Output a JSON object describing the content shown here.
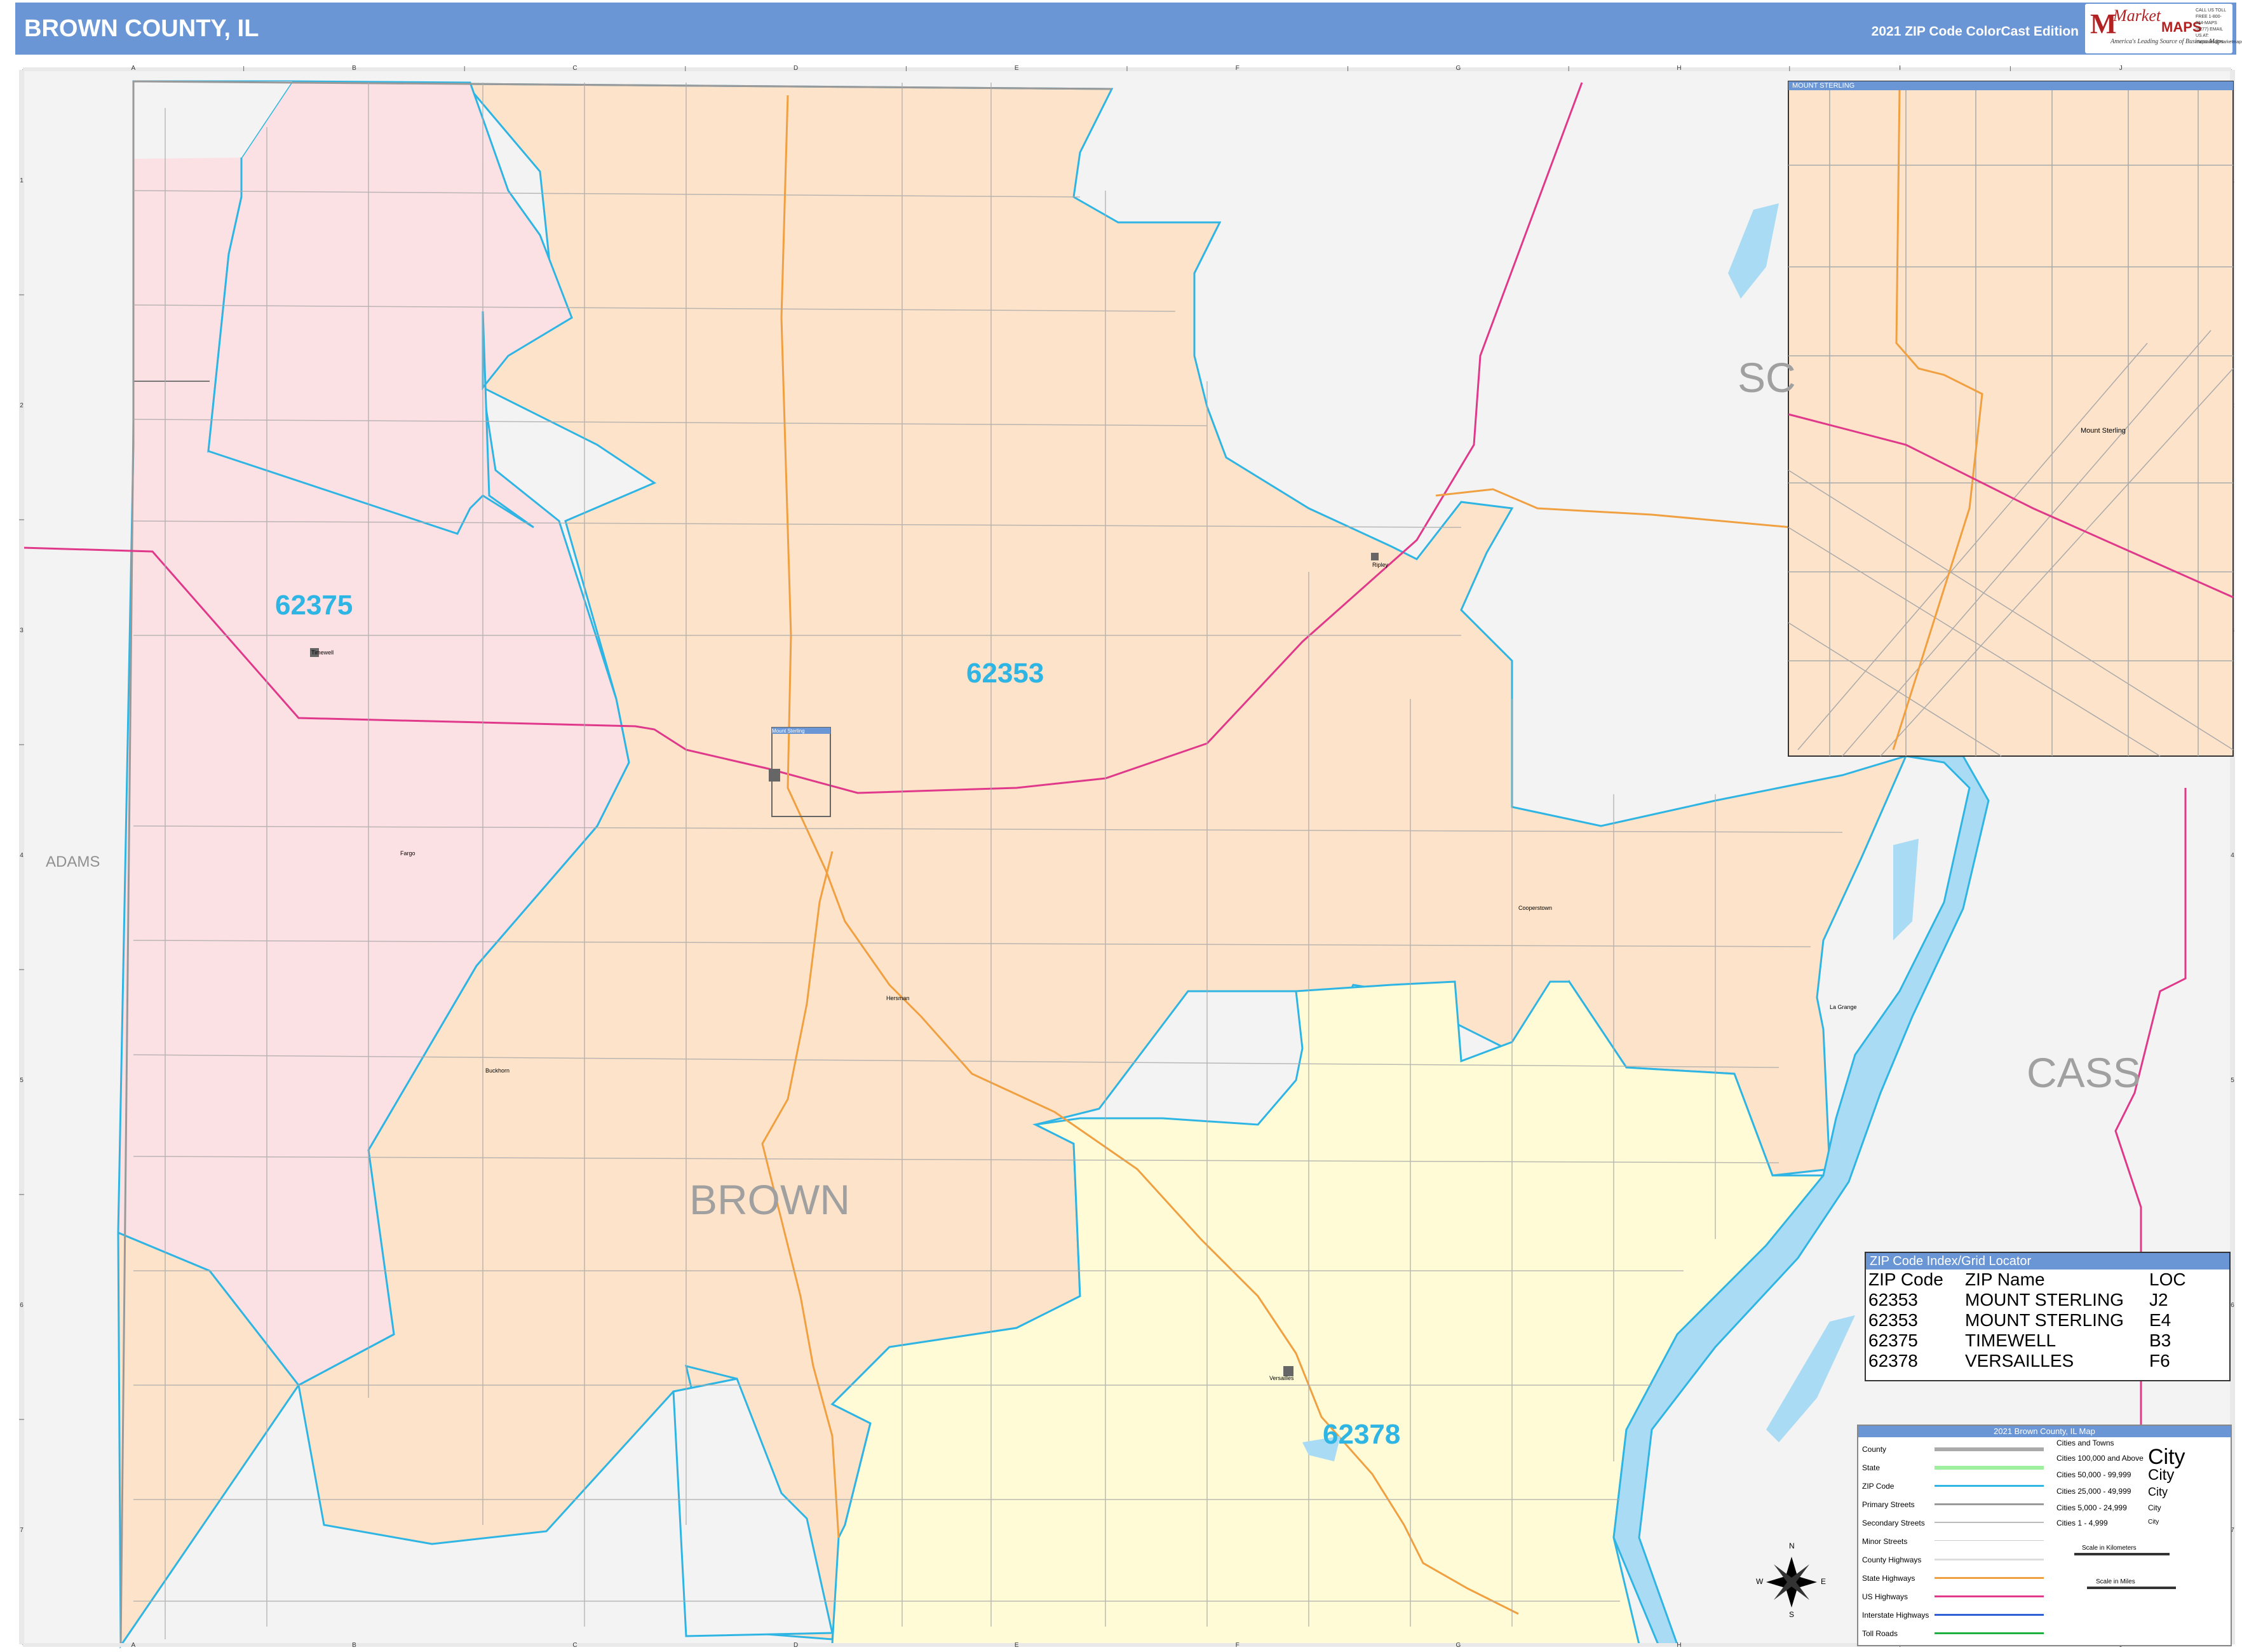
{
  "header": {
    "title": "BROWN COUNTY, IL",
    "edition": "2021 ZIP Code ColorCast Edition",
    "logo": {
      "brand": "Market",
      "brand2": "MAPS",
      "tagline": "America's Leading Source of Business Maps",
      "slogan": "On Target, On Time",
      "contact": "CALL US TOLL FREE 1-800-334-MAPS (6277) EMAIL US AT: mapsales@marketmaps.com"
    }
  },
  "grid": {
    "columns": [
      "A",
      "B",
      "C",
      "D",
      "E",
      "F",
      "G",
      "H",
      "I",
      "J"
    ],
    "rows": [
      "1",
      "2",
      "3",
      "4",
      "5",
      "6",
      "7"
    ]
  },
  "map": {
    "county_label": "BROWN",
    "neighbor_labels": [
      "ADAMS",
      "CASS",
      "SC"
    ],
    "zip_labels": [
      "62375",
      "62353",
      "62378"
    ],
    "towns": [
      "Timewell",
      "Fargo",
      "Buckhorn",
      "Mount Sterling",
      "Hersman",
      "Ripley",
      "Cooperstown",
      "La Grange",
      "Versailles"
    ],
    "inset_box_label": "MOUNT STERLING",
    "colors": {
      "zip_62375": "#fce1e4",
      "zip_62353": "#fde3c9",
      "zip_62378": "#fefbd6",
      "outside": "#f3f3f3",
      "zip_boundary": "#2fb5e3",
      "us_highway": "#e0388a",
      "state_highway": "#f0a040",
      "water": "#a9dcf4"
    }
  },
  "inset": {
    "title": "MOUNT STERLING",
    "town_label": "Mount Sterling"
  },
  "index": {
    "title": "ZIP Code Index/Grid Locator",
    "columns": [
      "ZIP Code",
      "ZIP Name",
      "LOC"
    ],
    "rows": [
      [
        "62353",
        "MOUNT STERLING",
        "J2"
      ],
      [
        "62353",
        "MOUNT STERLING",
        "E4"
      ],
      [
        "62375",
        "TIMEWELL",
        "B3"
      ],
      [
        "62378",
        "VERSAILLES",
        "F6"
      ]
    ]
  },
  "legend": {
    "title": "2021 Brown County, IL Map",
    "items": [
      "County",
      "State",
      "ZIP Code",
      "Primary Streets",
      "Secondary Streets",
      "Minor Streets",
      "County Highways",
      "State Highways",
      "US Highways",
      "Interstate Highways",
      "Toll Roads"
    ],
    "cities_title": "Cities and Towns",
    "cities": [
      "Cities 100,000 and Above",
      "Cities 50,000 - 99,999",
      "Cities 25,000 - 49,999",
      "Cities 5,000 - 24,999",
      "Cities 1 - 4,999"
    ],
    "city_word": "City",
    "scale_km": "Scale in Kilometers",
    "scale_mi": "Scale in Miles",
    "compass": [
      "N",
      "S",
      "E",
      "W"
    ]
  }
}
